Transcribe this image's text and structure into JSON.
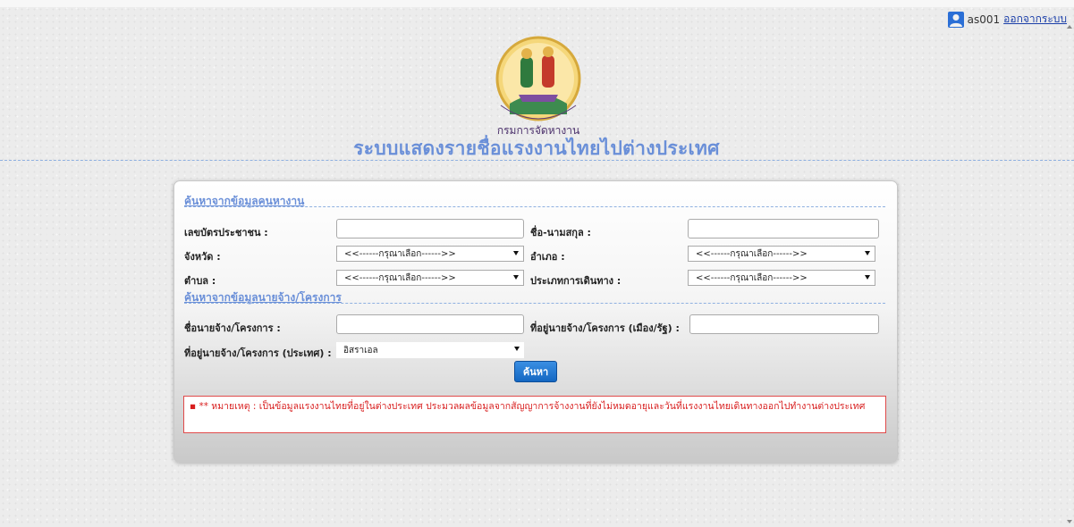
{
  "header": {
    "username": "as001",
    "logout_label": "ออกจากระบบ",
    "logo_text": "กรมการจัดหางาน",
    "page_title": "ระบบแสดงรายชื่อแรงงานไทยไปต่างประเทศ"
  },
  "worker_section": {
    "title": "ค้นหาจากข้อมูลคนหางาน",
    "id_label": "เลขบัตรประชาชน :",
    "id_value": "",
    "name_label": "ชื่อ-นามสกุล :",
    "name_value": "",
    "province_label": "จังหวัด :",
    "province_value": "<<------กรุณาเลือก------>>",
    "district_label": "อำเภอ :",
    "district_value": "<<------กรุณาเลือก------>>",
    "subdistrict_label": "ตำบล :",
    "subdistrict_value": "<<------กรุณาเลือก------>>",
    "travel_type_label": "ประเภทการเดินทาง :",
    "travel_type_value": "<<------กรุณาเลือก------>>"
  },
  "employer_section": {
    "title": "ค้นหาจากข้อมูลนายจ้าง/โครงการ",
    "employer_name_label": "ชื่อนายจ้าง/โครงการ :",
    "employer_name_value": "",
    "employer_city_label": "ที่อยู่นายจ้าง/โครงการ (เมือง/รัฐ) :",
    "employer_city_value": "",
    "employer_country_label": "ที่อยู่นายจ้าง/โครงการ (ประเทศ) :",
    "employer_country_value": "อิสราเอล"
  },
  "search_button_label": "ค้นหา",
  "note": {
    "prefix": "** หมายเหตุ :",
    "text": "เป็นข้อมูลแรงงานไทยที่อยู่ในต่างประเทศ ประมวลผลข้อมูลจากสัญญาการจ้างงานที่ยังไม่หมดอายุและวันที่แรงงานไทยเดินทางออกไปทำงานต่างประเทศ"
  },
  "colors": {
    "title_blue": "#6a8fd8",
    "link_blue": "#1a3ea8",
    "button_blue": "#1f74d0",
    "note_red": "#d81e1e"
  },
  "icons": {
    "user": "user-avatar-icon",
    "dropdown": "chevron-down-icon",
    "logo": "department-seal-logo"
  }
}
